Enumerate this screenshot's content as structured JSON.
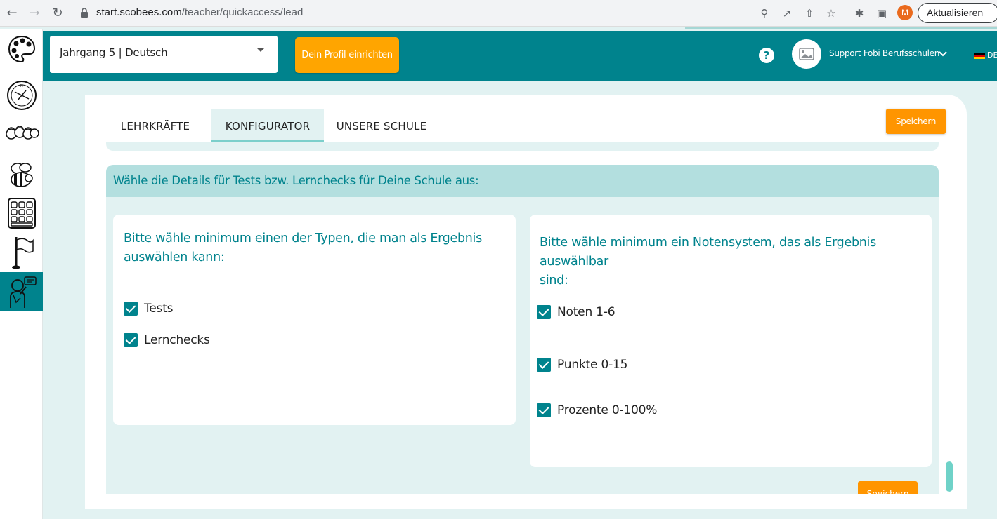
{
  "browser": {
    "url_host": "start.scobees.com",
    "url_path": "/teacher/quickaccess/lead",
    "profile_initial": "M",
    "update_label": "Aktualisieren"
  },
  "header": {
    "select_value": "Jahrgang 5 | Deutsch",
    "profile_button": "Dein Profil einrichten",
    "help_symbol": "?",
    "user_name": "Support Fobi Berufsschulen",
    "language": "DE"
  },
  "sidebar": {
    "items": [
      {
        "icon": "palette-icon",
        "active": false
      },
      {
        "icon": "compass-icon",
        "active": false
      },
      {
        "icon": "community-icon",
        "active": false
      },
      {
        "icon": "bee-icon",
        "active": false
      },
      {
        "icon": "calendar-icon",
        "active": false
      },
      {
        "icon": "flag-icon",
        "active": false
      },
      {
        "icon": "teacher-icon",
        "active": true
      }
    ]
  },
  "tabs": [
    {
      "label": "LEHRKRÄFTE",
      "active": false
    },
    {
      "label": "KONFIGURATOR",
      "active": true
    },
    {
      "label": "UNSERE SCHULE",
      "active": false
    }
  ],
  "save_label": "Speichern",
  "section": {
    "title": "Wähle die Details für Tests bzw. Lernchecks für Deine Schule aus:",
    "left_panel": {
      "title_line1": "Bitte wähle minimum einen der Typen, die man als Ergebnis",
      "title_line2": "auswählen kann:",
      "options": [
        {
          "label": "Tests",
          "checked": true
        },
        {
          "label": "Lernchecks",
          "checked": true
        }
      ]
    },
    "right_panel": {
      "title_line1": "Bitte wähle minimum ein Notensystem, das als Ergebnis auswählbar",
      "title_line2": "sind:",
      "options": [
        {
          "label": "Noten 1-6",
          "checked": true
        },
        {
          "label": "Punkte 0-15",
          "checked": true
        },
        {
          "label": "Prozente 0-100%",
          "checked": true
        }
      ]
    }
  },
  "colors": {
    "teal": "#00838d",
    "orange": "#ff9500",
    "light_teal": "#e2f2f2",
    "header_teal": "#b3dfdf"
  }
}
